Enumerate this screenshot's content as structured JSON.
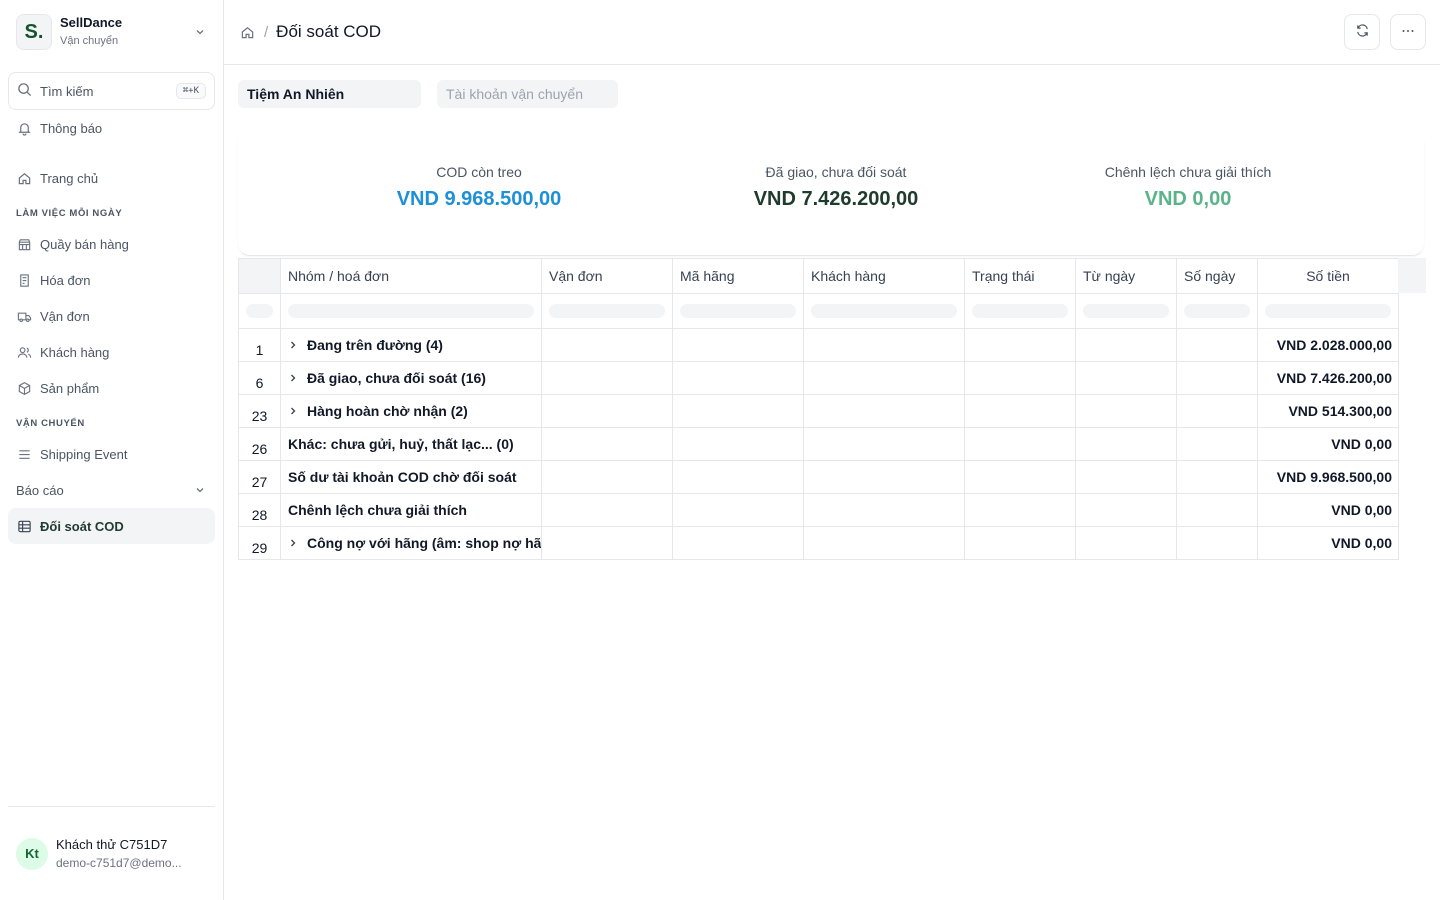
{
  "sidebar": {
    "brand": {
      "logo": "S.",
      "name": "SellDance",
      "sub": "Vận chuyển"
    },
    "search": {
      "label": "Tìm kiếm",
      "shortcut": "⌘+K"
    },
    "notifications": "Thông báo",
    "home": "Trang chủ",
    "sections": {
      "daily": "LÀM VIỆC MỖI NGÀY",
      "shipping": "VẬN CHUYỂN"
    },
    "daily_items": [
      "Quầy bán hàng",
      "Hóa đơn",
      "Vận đơn",
      "Khách hàng",
      "Sản phẩm"
    ],
    "shipping_items": [
      "Shipping Event"
    ],
    "reports": "Báo cáo",
    "active_item": "Đối soát COD",
    "user": {
      "initials": "Kt",
      "name": "Khách thử C751D7",
      "email": "demo-c751d7@demo..."
    }
  },
  "header": {
    "breadcrumb_title": "Đối soát COD"
  },
  "filters": {
    "shop": "Tiệm An Nhiên",
    "account_placeholder": "Tài khoản vận chuyển"
  },
  "stats": [
    {
      "label": "COD còn treo",
      "value": "VND 9.968.500,00",
      "color": "#1e90d6"
    },
    {
      "label": "Đã giao, chưa đối soát",
      "value": "VND 7.426.200,00",
      "color": "#1f3b2d"
    },
    {
      "label": "Chênh lệch chưa giải thích",
      "value": "VND 0,00",
      "color": "#5bb38a"
    }
  ],
  "table": {
    "columns": [
      "Nhóm / hoá đơn",
      "Vận đơn",
      "Mã hãng",
      "Khách hàng",
      "Trạng thái",
      "Từ ngày",
      "Số ngày",
      "Số tiền"
    ],
    "rows": [
      {
        "index": "1",
        "label": "Đang trên đường (4)",
        "expandable": true,
        "amount": "VND 2.028.000,00"
      },
      {
        "index": "6",
        "label": "Đã giao, chưa đối soát (16)",
        "expandable": true,
        "amount": "VND 7.426.200,00"
      },
      {
        "index": "23",
        "label": "Hàng hoàn chờ nhận (2)",
        "expandable": true,
        "amount": "VND 514.300,00"
      },
      {
        "index": "26",
        "label": "Khác: chưa gửi, huỷ, thất lạc... (0)",
        "expandable": false,
        "amount": "VND 0,00"
      },
      {
        "index": "27",
        "label": "Số dư tài khoản COD chờ đối soát",
        "expandable": false,
        "amount": "VND 9.968.500,00"
      },
      {
        "index": "28",
        "label": "Chênh lệch chưa giải thích",
        "expandable": false,
        "amount": "VND 0,00"
      },
      {
        "index": "29",
        "label": "Công nợ với hãng (âm: shop nợ hãng)",
        "expandable": true,
        "amount": "VND 0,00"
      }
    ]
  }
}
